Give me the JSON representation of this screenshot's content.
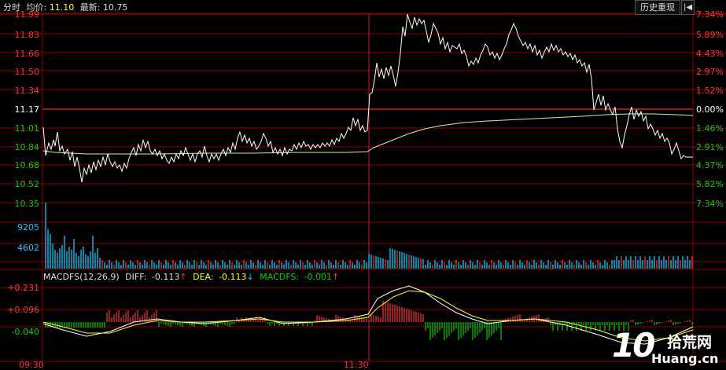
{
  "header": {
    "mode_label": "分时",
    "avg_label": "均价:",
    "avg_value": "11.10",
    "latest_label": "最新:",
    "latest_value": "10.75",
    "history_button": "历史重现",
    "back_icon": "back-to-start-icon"
  },
  "price_axis_left": [
    "11.99",
    "11.83",
    "11.66",
    "11.50",
    "11.34",
    "11.17",
    "11.01",
    "10.84",
    "10.68",
    "10.52",
    "10.35"
  ],
  "percent_axis_right": [
    "7.34%",
    "5.89%",
    "4.43%",
    "2.97%",
    "1.52%",
    "0.00%",
    "1.46%",
    "2.91%",
    "4.37%",
    "5.82%",
    "7.34%"
  ],
  "volume_axis": [
    "9205",
    "4602"
  ],
  "macd": {
    "title": "MACDFS(12,26,9)",
    "diff_label": "DIFF:",
    "diff_value": "-0.113",
    "dea_label": "DEA:",
    "dea_value": "-0.113",
    "macdfs_label": "MACDFS:",
    "macdfs_value": "-0.001",
    "axis": [
      "+0.231",
      "+0.096",
      "-0.040"
    ]
  },
  "time_axis": [
    "09:30",
    "11:30"
  ],
  "watermark": {
    "number": "10",
    "cn": "拾荒网",
    "en": "Huang.cn"
  },
  "colors": {
    "up": "#ff3232",
    "down": "#00d000",
    "neutral": "#ffffff",
    "avg": "#ffff00",
    "grid": "#8b0000",
    "text_yellow": "#ffff00",
    "text_cyan": "#00cfff"
  }
}
